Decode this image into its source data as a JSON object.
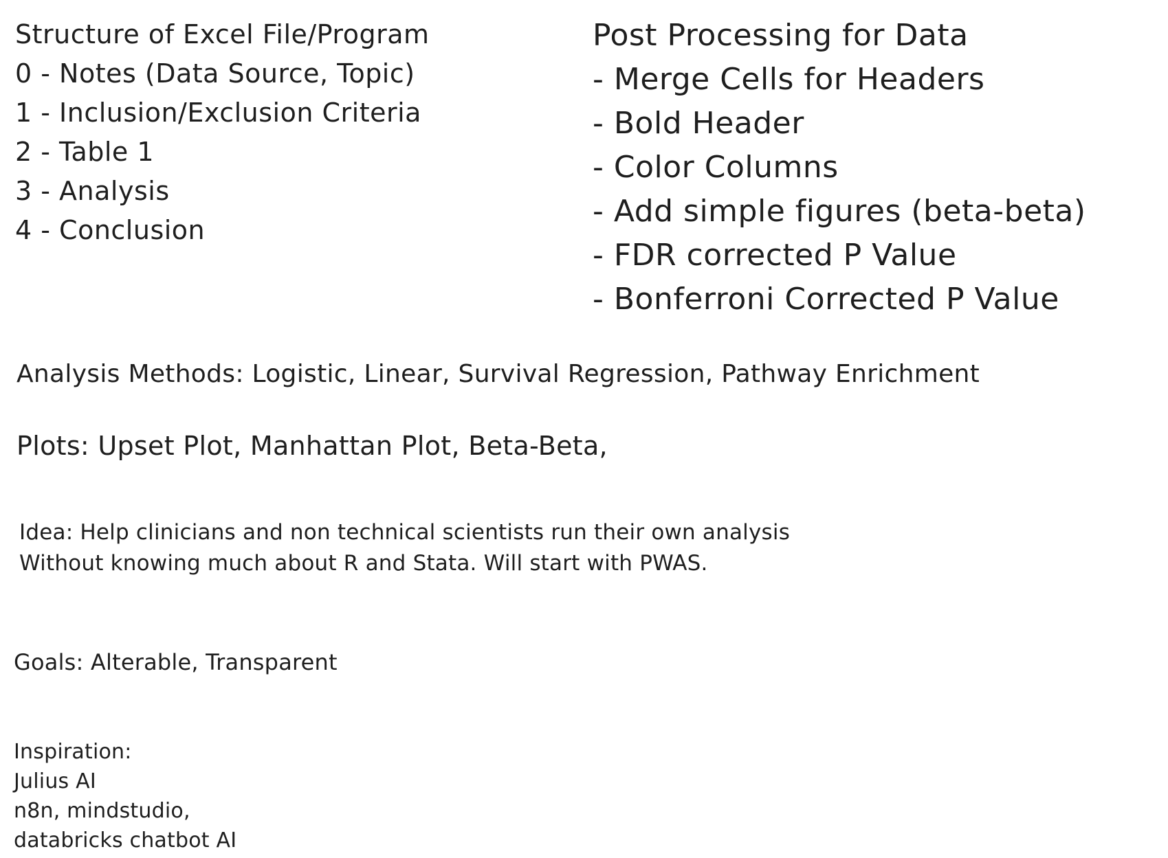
{
  "structure": {
    "title": "Structure of Excel File/Program",
    "items": [
      "0 - Notes (Data Source, Topic)",
      "1 - Inclusion/Exclusion Criteria",
      "2 - Table 1",
      "3 - Analysis",
      "4 - Conclusion"
    ]
  },
  "post_processing": {
    "title": "Post Processing for Data",
    "items": [
      "- Merge Cells for Headers",
      "- Bold Header",
      "- Color Columns",
      "- Add simple figures (beta-beta)",
      "- FDR corrected P Value",
      "- Bonferroni Corrected P Value"
    ]
  },
  "analysis_methods": "Analysis Methods: Logistic, Linear, Survival Regression, Pathway Enrichment",
  "plots": "Plots: Upset Plot, Manhattan Plot, Beta-Beta,",
  "idea": {
    "lines": [
      "Idea: Help clinicians and non technical scientists run their own analysis",
      "Without knowing much about R and Stata. Will start with PWAS."
    ]
  },
  "goals": "Goals: Alterable, Transparent",
  "inspiration": {
    "lines": [
      "Inspiration:",
      "Julius AI",
      "n8n, mindstudio,",
      "databricks chatbot AI"
    ]
  }
}
